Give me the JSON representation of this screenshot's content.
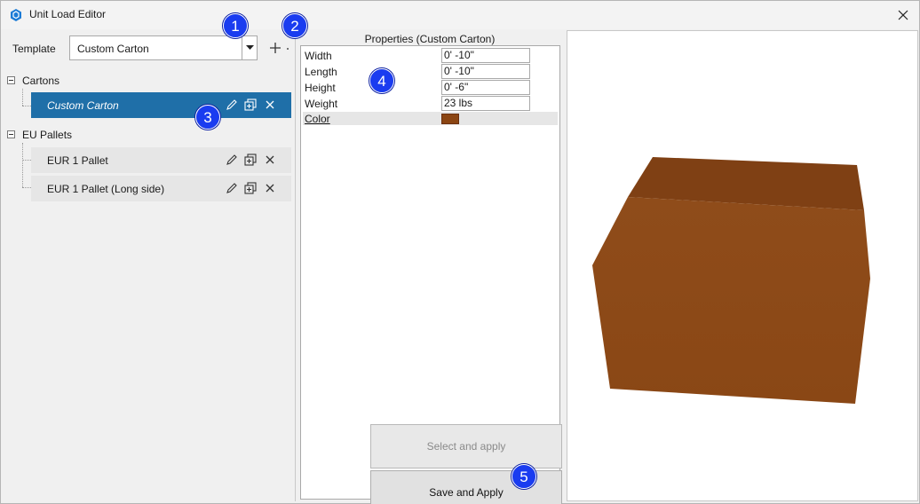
{
  "window": {
    "title": "Unit Load Editor"
  },
  "template_bar": {
    "label": "Template",
    "selected": "Custom Carton"
  },
  "tree": {
    "groups": [
      {
        "label": "Cartons",
        "items": [
          {
            "label": "Custom Carton",
            "selected": true
          }
        ]
      },
      {
        "label": "EU Pallets",
        "items": [
          {
            "label": "EUR 1 Pallet",
            "selected": false
          },
          {
            "label": "EUR 1 Pallet (Long side)",
            "selected": false
          }
        ]
      }
    ]
  },
  "properties": {
    "title": "Properties (Custom Carton)",
    "rows": [
      {
        "name": "Width",
        "value": "0' -10\""
      },
      {
        "name": "Length",
        "value": "0' -10\""
      },
      {
        "name": "Height",
        "value": "0' -6\""
      },
      {
        "name": "Weight",
        "value": "23 lbs"
      }
    ],
    "color": {
      "name": "Color",
      "value": "#8b4513"
    }
  },
  "buttons": {
    "select_apply": "Select and apply",
    "save_apply": "Save and Apply"
  },
  "callouts": [
    "1",
    "2",
    "3",
    "4",
    "5"
  ],
  "colors": {
    "selection": "#1f6fa8",
    "box_front": "#8e4a18",
    "box_top": "#7d3f14",
    "callout": "#1a3cf0"
  }
}
